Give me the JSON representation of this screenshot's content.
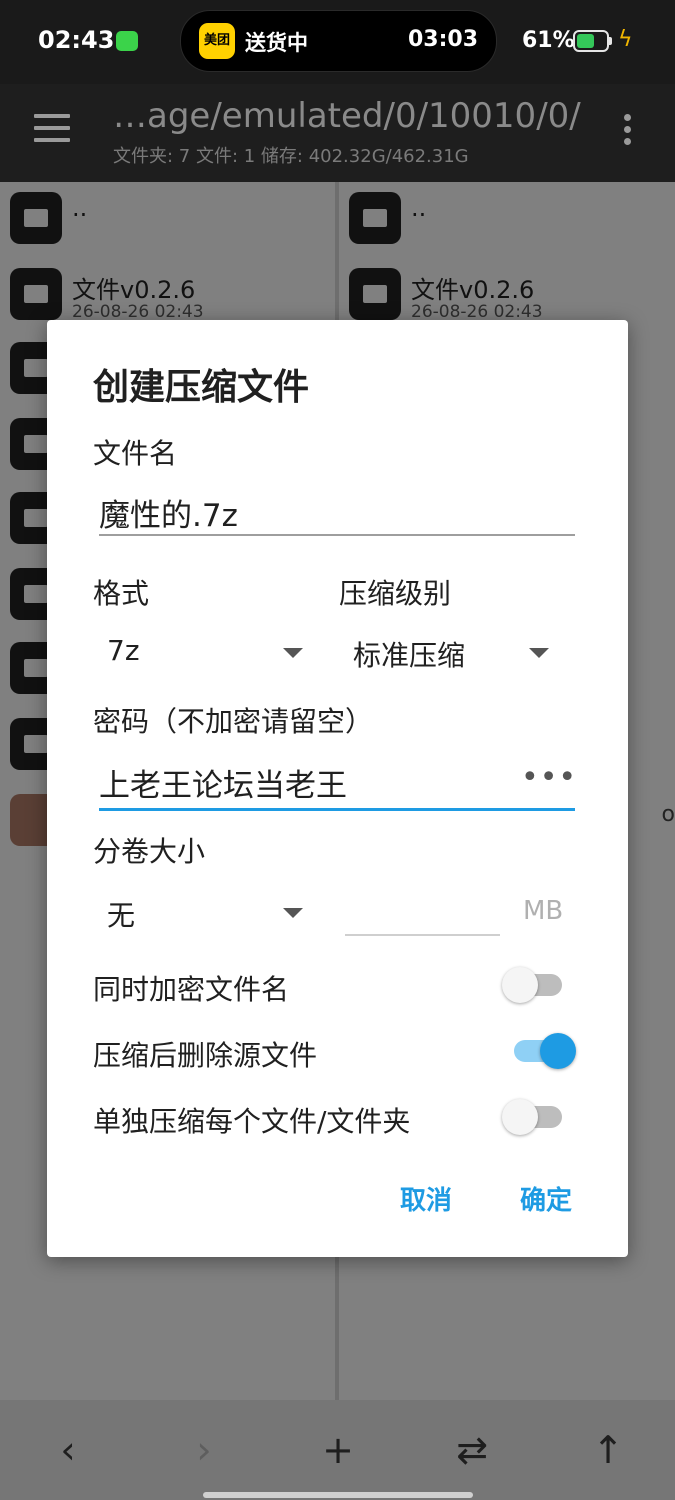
{
  "status_bar": {
    "time": "02:43",
    "island_app": "美团",
    "island_text": "送货中",
    "island_timer": "03:03",
    "battery_percent": "61%",
    "battery_level": 0.61
  },
  "toolbar": {
    "path": "…age/emulated/0/10010/0/",
    "info": "文件夹: 7  文件: 1  储存: 402.32G/462.31G"
  },
  "panes": {
    "parent_label": "..",
    "folder_name": "文件v0.2.6",
    "folder_date": "26-08-26 02:43",
    "right_tail": "o"
  },
  "dialog": {
    "title": "创建压缩文件",
    "filename_label": "文件名",
    "filename_value": "魔性的.7z",
    "format_label": "格式",
    "format_value": "7z",
    "level_label": "压缩级别",
    "level_value": "标准压缩",
    "password_label": "密码（不加密请留空）",
    "password_value": "上老王论坛当老王",
    "password_toggle": "•••",
    "split_label": "分卷大小",
    "split_value": "无",
    "split_unit": "MB",
    "options": [
      {
        "label": "同时加密文件名",
        "on": false
      },
      {
        "label": "压缩后删除源文件",
        "on": true
      },
      {
        "label": "单独压缩每个文件/文件夹",
        "on": false
      }
    ],
    "cancel": "取消",
    "ok": "确定"
  },
  "bottom_nav": {
    "back": "‹",
    "forward": "›",
    "add": "+",
    "swap": "⇄",
    "up": "↑"
  }
}
